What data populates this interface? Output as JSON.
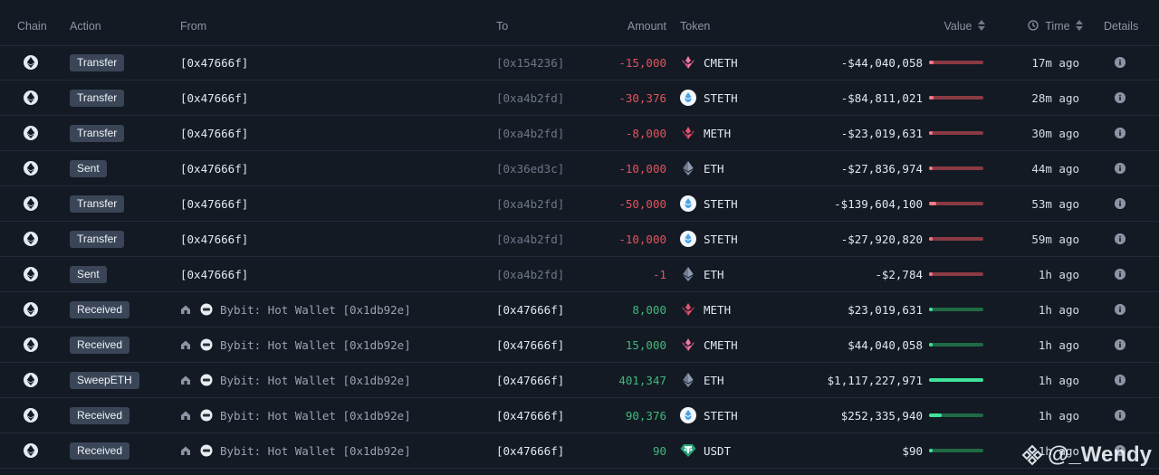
{
  "headers": {
    "chain": "Chain",
    "action": "Action",
    "from": "From",
    "to": "To",
    "amount": "Amount",
    "token": "Token",
    "value": "Value",
    "time": "Time",
    "details": "Details"
  },
  "colors": {
    "negative": "#e2535c",
    "positive": "#3fb97a",
    "badge_bg": "#3a4657",
    "background": "#131a24"
  },
  "rows": [
    {
      "chain_icon": "ethereum-icon",
      "action": "Transfer",
      "from_type": "addr",
      "from": "[0x47666f]",
      "to": "[0x154236]",
      "to_style": "dim",
      "amount": "-15,000",
      "sign": "neg",
      "token_icon": "cmeth-icon",
      "token": "CMETH",
      "value": "-$44,040,058",
      "bar": 0.08,
      "time": "17m ago"
    },
    {
      "chain_icon": "ethereum-icon",
      "action": "Transfer",
      "from_type": "addr",
      "from": "[0x47666f]",
      "to": "[0xa4b2fd]",
      "to_style": "dim",
      "amount": "-30,376",
      "sign": "neg",
      "token_icon": "steth-icon",
      "token": "STETH",
      "value": "-$84,811,021",
      "bar": 0.08,
      "time": "28m ago"
    },
    {
      "chain_icon": "ethereum-icon",
      "action": "Transfer",
      "from_type": "addr",
      "from": "[0x47666f]",
      "to": "[0xa4b2fd]",
      "to_style": "dim",
      "amount": "-8,000",
      "sign": "neg",
      "token_icon": "meth-icon",
      "token": "METH",
      "value": "-$23,019,631",
      "bar": 0.03,
      "time": "30m ago"
    },
    {
      "chain_icon": "ethereum-icon",
      "action": "Sent",
      "from_type": "addr",
      "from": "[0x47666f]",
      "to": "[0x36ed3c]",
      "to_style": "dim",
      "amount": "-10,000",
      "sign": "neg",
      "token_icon": "eth-icon",
      "token": "ETH",
      "value": "-$27,836,974",
      "bar": 0.04,
      "time": "44m ago"
    },
    {
      "chain_icon": "ethereum-icon",
      "action": "Transfer",
      "from_type": "addr",
      "from": "[0x47666f]",
      "to": "[0xa4b2fd]",
      "to_style": "dim",
      "amount": "-50,000",
      "sign": "neg",
      "token_icon": "steth-icon",
      "token": "STETH",
      "value": "-$139,604,100",
      "bar": 0.13,
      "time": "53m ago"
    },
    {
      "chain_icon": "ethereum-icon",
      "action": "Transfer",
      "from_type": "addr",
      "from": "[0x47666f]",
      "to": "[0xa4b2fd]",
      "to_style": "dim",
      "amount": "-10,000",
      "sign": "neg",
      "token_icon": "steth-icon",
      "token": "STETH",
      "value": "-$27,920,820",
      "bar": 0.04,
      "time": "59m ago"
    },
    {
      "chain_icon": "ethereum-icon",
      "action": "Sent",
      "from_type": "addr",
      "from": "[0x47666f]",
      "to": "[0xa4b2fd]",
      "to_style": "dim",
      "amount": "-1",
      "sign": "neg",
      "token_icon": "eth-icon",
      "token": "ETH",
      "value": "-$2,784",
      "bar": 0.0,
      "time": "1h ago"
    },
    {
      "chain_icon": "ethereum-icon",
      "action": "Received",
      "from_type": "entity",
      "from": "Bybit: Hot Wallet [0x1db92e]",
      "to": "[0x47666f]",
      "to_style": "bright",
      "amount": "8,000",
      "sign": "pos",
      "token_icon": "meth-icon",
      "token": "METH",
      "value": "$23,019,631",
      "bar": 0.02,
      "time": "1h ago"
    },
    {
      "chain_icon": "ethereum-icon",
      "action": "Received",
      "from_type": "entity",
      "from": "Bybit: Hot Wallet [0x1db92e]",
      "to": "[0x47666f]",
      "to_style": "bright",
      "amount": "15,000",
      "sign": "pos",
      "token_icon": "cmeth-icon",
      "token": "CMETH",
      "value": "$44,040,058",
      "bar": 0.04,
      "time": "1h ago"
    },
    {
      "chain_icon": "ethereum-icon",
      "action": "SweepETH",
      "from_type": "entity",
      "from": "Bybit: Hot Wallet [0x1db92e]",
      "to": "[0x47666f]",
      "to_style": "bright",
      "amount": "401,347",
      "sign": "pos",
      "token_icon": "eth-icon",
      "token": "ETH",
      "value": "$1,117,227,971",
      "bar": 1.0,
      "time": "1h ago"
    },
    {
      "chain_icon": "ethereum-icon",
      "action": "Received",
      "from_type": "entity",
      "from": "Bybit: Hot Wallet [0x1db92e]",
      "to": "[0x47666f]",
      "to_style": "bright",
      "amount": "90,376",
      "sign": "pos",
      "token_icon": "steth-icon",
      "token": "STETH",
      "value": "$252,335,940",
      "bar": 0.23,
      "time": "1h ago"
    },
    {
      "chain_icon": "ethereum-icon",
      "action": "Received",
      "from_type": "entity",
      "from": "Bybit: Hot Wallet [0x1db92e]",
      "to": "[0x47666f]",
      "to_style": "bright",
      "amount": "90",
      "sign": "pos",
      "token_icon": "usdt-icon",
      "token": "USDT",
      "value": "$90",
      "bar": 0.0,
      "time": "1h ago"
    }
  ],
  "watermark": {
    "text": "@_Wendy",
    "icon": "binance-logo-icon"
  }
}
